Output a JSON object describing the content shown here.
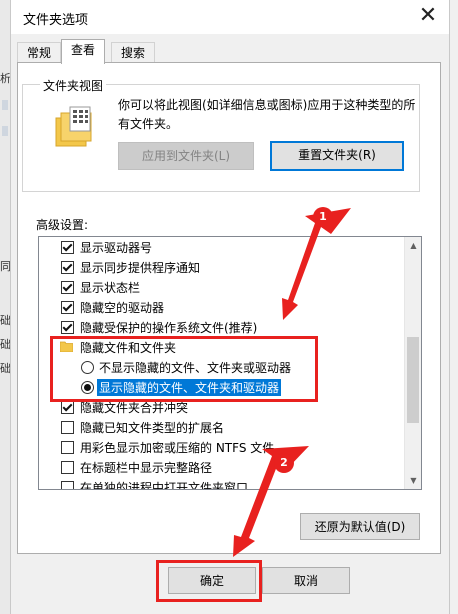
{
  "background": {
    "left_labels": [
      "析",
      "同",
      "础",
      "础",
      "础"
    ]
  },
  "dialog": {
    "title": "文件夹选项",
    "close_glyph": "✕"
  },
  "tabs": [
    {
      "label": "常规",
      "active": false
    },
    {
      "label": "查看",
      "active": true
    },
    {
      "label": "搜索",
      "active": false
    }
  ],
  "folder_views": {
    "title": "文件夹视图",
    "description": "你可以将此视图(如详细信息或图标)应用于这种类型的所有文件夹。",
    "apply_button": "应用到文件夹(L)",
    "reset_button": "重置文件夹(R)"
  },
  "advanced": {
    "label": "高级设置:",
    "items": [
      {
        "text": "显示驱动器号",
        "type": "checkbox",
        "checked": true
      },
      {
        "text": "显示同步提供程序通知",
        "type": "checkbox",
        "checked": true
      },
      {
        "text": "显示状态栏",
        "type": "checkbox",
        "checked": true
      },
      {
        "text": "隐藏空的驱动器",
        "type": "checkbox",
        "checked": true
      },
      {
        "text": "隐藏受保护的操作系统文件(推荐)",
        "type": "checkbox",
        "checked": true
      },
      {
        "text": "隐藏文件和文件夹",
        "type": "folder"
      },
      {
        "text": "不显示隐藏的文件、文件夹或驱动器",
        "type": "radio",
        "checked": false
      },
      {
        "text": "显示隐藏的文件、文件夹和驱动器",
        "type": "radio",
        "checked": true,
        "selected": true
      },
      {
        "text": "隐藏文件夹合并冲突",
        "type": "checkbox",
        "checked": true
      },
      {
        "text": "隐藏已知文件类型的扩展名",
        "type": "checkbox",
        "checked": false
      },
      {
        "text": "用彩色显示加密或压缩的 NTFS 文件",
        "type": "checkbox",
        "checked": false
      },
      {
        "text": "在标题栏中显示完整路径",
        "type": "checkbox",
        "checked": false
      },
      {
        "text": "在单独的进程中打开文件夹窗口",
        "type": "checkbox",
        "checked": false
      }
    ],
    "restore_button": "还原为默认值(D)"
  },
  "footer": {
    "ok_button": "确定",
    "cancel_button": "取消"
  },
  "annotations": {
    "badge1": "1",
    "badge2": "2",
    "color": "#e8211f"
  },
  "colors": {
    "selection": "#0078d7",
    "focus_border": "#0078d7",
    "dialog_bg": "#f0f0f0"
  }
}
